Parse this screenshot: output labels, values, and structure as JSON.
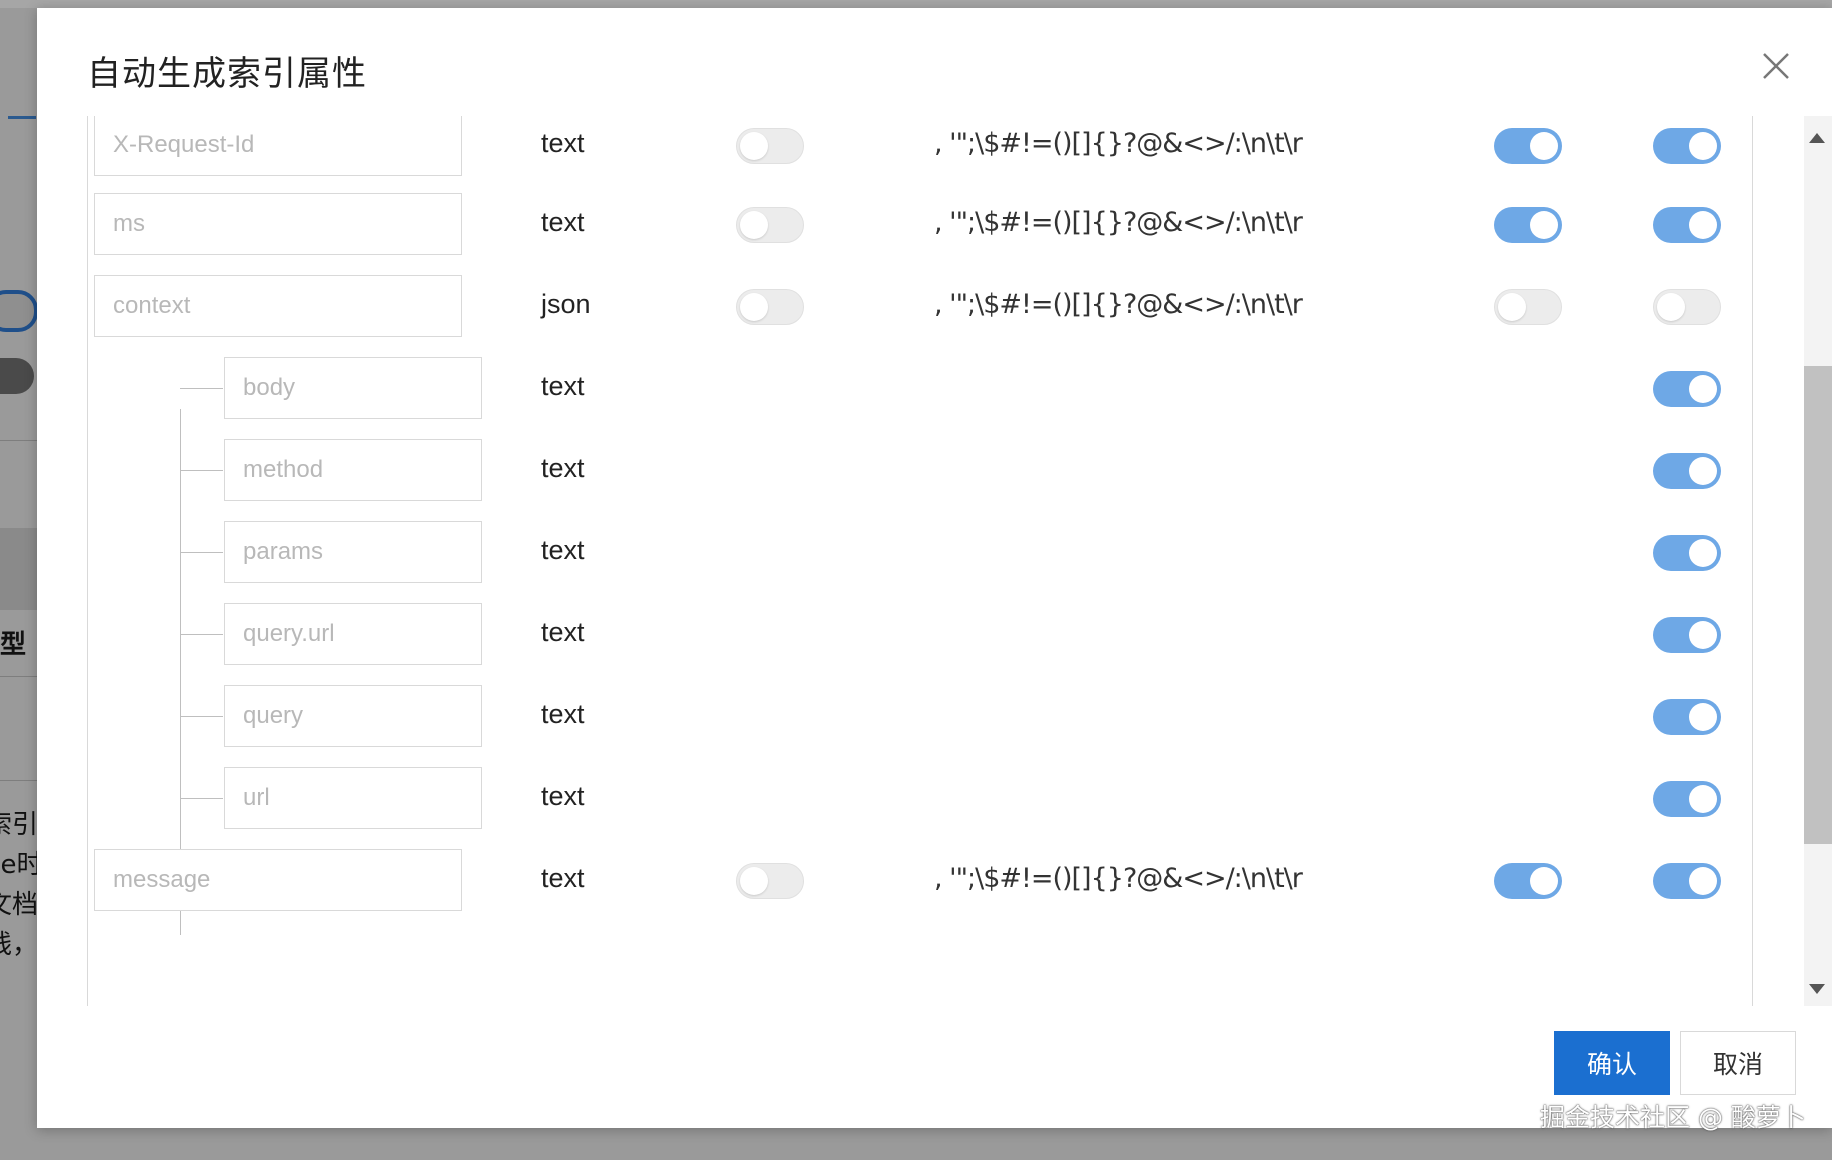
{
  "dialog": {
    "title": "自动生成索引属性",
    "confirm_label": "确认",
    "cancel_label": "取消"
  },
  "background": {
    "fragments": [
      "型",
      "索引",
      "de时",
      "文档",
      "线，"
    ]
  },
  "rows": [
    {
      "name": "X-Request-Id",
      "type": "text",
      "toggle_a": false,
      "delimiter": ", '\";\\$#!=()[]{}?@&<>/:\\n\\t\\r",
      "toggle_b": true,
      "toggle_c": true
    },
    {
      "name": "ms",
      "type": "text",
      "toggle_a": false,
      "delimiter": ", '\";\\$#!=()[]{}?@&<>/:\\n\\t\\r",
      "toggle_b": true,
      "toggle_c": true
    },
    {
      "name": "context",
      "type": "json",
      "toggle_a": false,
      "delimiter": ", '\";\\$#!=()[]{}?@&<>/:\\n\\t\\r",
      "toggle_b": false,
      "toggle_c": false
    },
    {
      "name": "body",
      "type": "text",
      "toggle_c": true,
      "child": true
    },
    {
      "name": "method",
      "type": "text",
      "toggle_c": true,
      "child": true
    },
    {
      "name": "params",
      "type": "text",
      "toggle_c": true,
      "child": true
    },
    {
      "name": "query.url",
      "type": "text",
      "toggle_c": true,
      "child": true
    },
    {
      "name": "query",
      "type": "text",
      "toggle_c": true,
      "child": true
    },
    {
      "name": "url",
      "type": "text",
      "toggle_c": true,
      "child": true
    },
    {
      "name": "message",
      "type": "text",
      "toggle_a": false,
      "delimiter": ", '\";\\$#!=()[]{}?@&<>/:\\n\\t\\r",
      "toggle_b": true,
      "toggle_c": true
    }
  ],
  "watermark": "掘金技术社区 @ 酸萝卜",
  "colors": {
    "toggle_on": "#6ea8e6",
    "primary": "#1b6fd0"
  }
}
